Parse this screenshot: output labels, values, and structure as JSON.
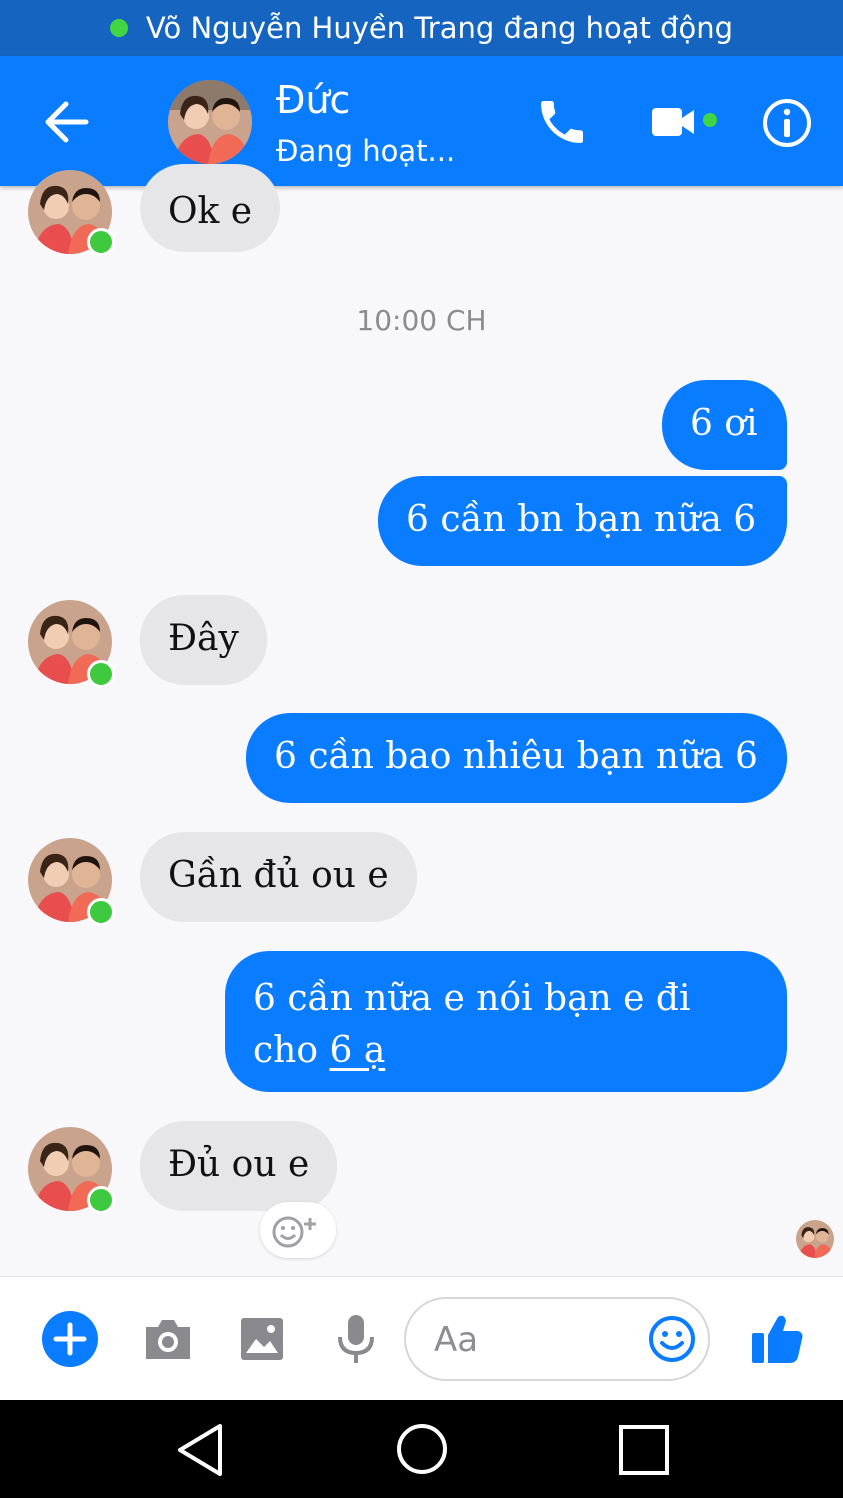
{
  "status_strip": {
    "text": "Võ Nguyễn Huyền Trang đang hoạt động"
  },
  "header": {
    "contact_name": "Đức",
    "contact_status": "Đang hoạt...",
    "icons": {
      "back": "arrow-left-icon",
      "call": "phone-icon",
      "video": "video-camera-icon",
      "info": "info-icon"
    }
  },
  "conversation": {
    "timestamp": "10:00 CH",
    "messages": [
      {
        "direction": "in",
        "text": "Ok e"
      },
      {
        "direction": "out",
        "text": "6 ơi"
      },
      {
        "direction": "out",
        "text": "6 cần bn bạn nữa 6"
      },
      {
        "direction": "in",
        "text": "Đây"
      },
      {
        "direction": "out",
        "text": "6 cần bao nhiêu bạn nữa 6"
      },
      {
        "direction": "in",
        "text": "Gần đủ ou e"
      },
      {
        "direction": "out",
        "text_line1": "6 cần nữa e nói bạn e đi",
        "text_line2_prefix": "cho ",
        "text_line2_link": "6 ạ"
      },
      {
        "direction": "in",
        "text": "Đủ ou e"
      }
    ]
  },
  "composer": {
    "placeholder": "Aa",
    "icons": [
      "plus-icon",
      "camera-icon",
      "image-icon",
      "microphone-icon",
      "emoji-icon",
      "thumbs-up-icon"
    ]
  },
  "colors": {
    "accent": "#0a7cff",
    "status_strip": "#1565c0",
    "online": "#3ec93e"
  }
}
